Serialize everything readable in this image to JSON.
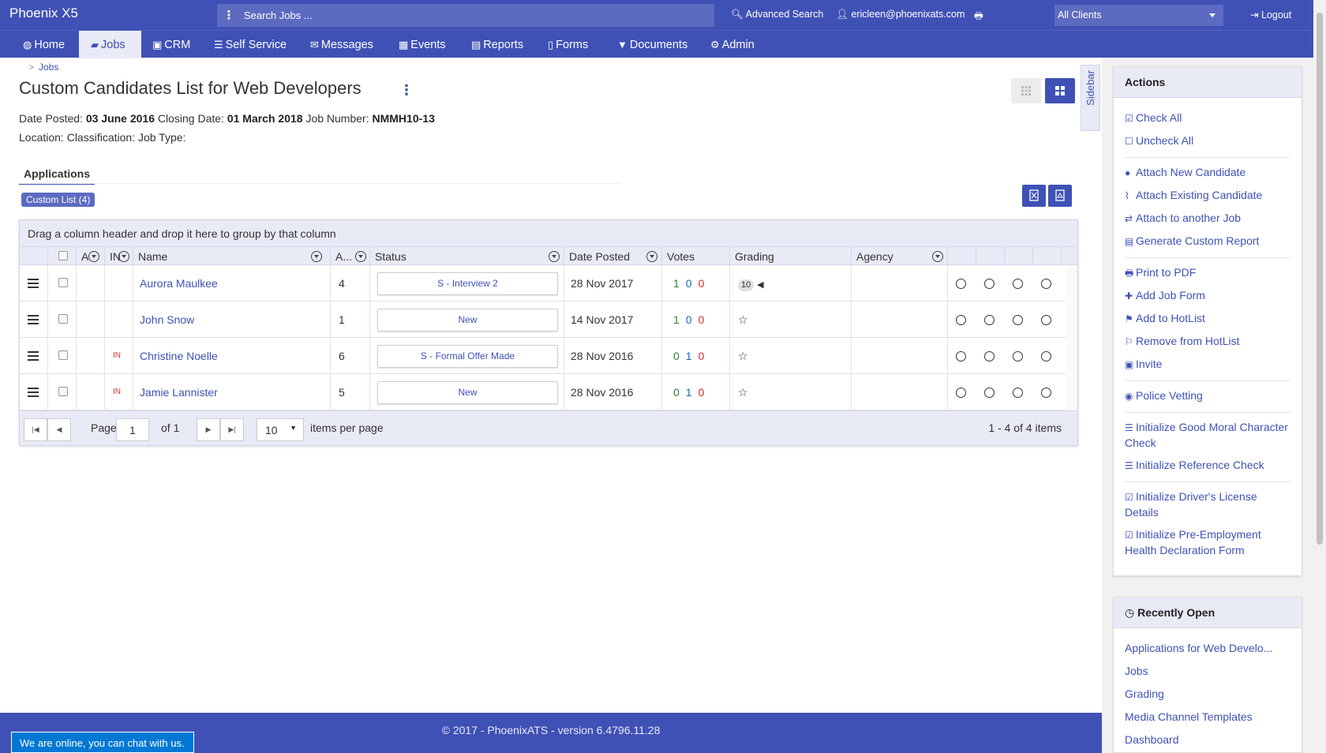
{
  "topbar": {
    "brand": "Phoenix X5",
    "search_placeholder": "Search Jobs ...",
    "advanced_search": "Advanced Search",
    "user_email": "ericleen@phoenixats.com",
    "client_select": "All Clients",
    "logout": "Logout"
  },
  "nav": [
    {
      "label": "Home",
      "icon": "globe-icon"
    },
    {
      "label": "Jobs",
      "icon": "folder-open-icon",
      "active": true
    },
    {
      "label": "CRM",
      "icon": "briefcase-icon"
    },
    {
      "label": "Self Service",
      "icon": "list-icon"
    },
    {
      "label": "Messages",
      "icon": "envelope-icon"
    },
    {
      "label": "Events",
      "icon": "calendar-icon"
    },
    {
      "label": "Reports",
      "icon": "report-icon"
    },
    {
      "label": "Forms",
      "icon": "file-icon"
    },
    {
      "label": "Documents",
      "icon": "filter-icon"
    },
    {
      "label": "Admin",
      "icon": "gear-icon"
    }
  ],
  "breadcrumb": {
    "separator": ">",
    "link": "Jobs"
  },
  "page": {
    "title": "Custom Candidates List for Web Developers",
    "date_posted_label": "Date Posted:",
    "date_posted": "03 June 2016",
    "closing_label": "Closing Date:",
    "closing_date": "01 March 2018",
    "job_number_label": "Job Number:",
    "job_number": "NMMH10-13",
    "meta2": "Location: Classification: Job Type:"
  },
  "sidebar_tab": "Sidebar",
  "tabs": {
    "applications": "Applications",
    "custom_list": "Custom List (4)"
  },
  "grid": {
    "group_hint": "Drag a column header and drop it here to group by that column",
    "headers": {
      "a": "A",
      "in": "IN",
      "name": "Name",
      "a2": "A...",
      "status": "Status",
      "date_posted": "Date Posted",
      "votes": "Votes",
      "grading": "Grading",
      "agency": "Agency"
    },
    "rows": [
      {
        "in": "",
        "name": "Aurora Maulkee",
        "a": "4",
        "status": "S - Interview 2",
        "date": "28 Nov 2017",
        "votes": [
          "1",
          "0",
          "0"
        ],
        "grading_badge": "10",
        "grading": ""
      },
      {
        "in": "",
        "name": "John Snow",
        "a": "1",
        "status": "New",
        "date": "14 Nov 2017",
        "votes": [
          "1",
          "0",
          "0"
        ],
        "grading_badge": "",
        "grading": "☆"
      },
      {
        "in": "IN",
        "name": "Christine Noelle",
        "a": "6",
        "status": "S - Formal Offer Made",
        "date": "28 Nov 2016",
        "votes": [
          "0",
          "1",
          "0"
        ],
        "grading_badge": "",
        "grading": "☆"
      },
      {
        "in": "IN",
        "name": "Jamie Lannister",
        "a": "5",
        "status": "New",
        "date": "28 Nov 2016",
        "votes": [
          "0",
          "1",
          "0"
        ],
        "grading_badge": "",
        "grading": "☆"
      }
    ],
    "pager": {
      "page_label": "Page",
      "page_value": "1",
      "of_label": "of 1",
      "per_page": "10",
      "per_page_label": "items per page",
      "summary": "1 - 4 of 4 items"
    }
  },
  "actions": {
    "title": "Actions",
    "items": [
      {
        "label": "Check All",
        "icon": "check-square-icon"
      },
      {
        "label": "Uncheck All",
        "icon": "square-icon"
      },
      {
        "label": "Attach New Candidate",
        "icon": "user-icon"
      },
      {
        "label": "Attach Existing Candidate",
        "icon": "paperclip-icon"
      },
      {
        "label": "Attach to another Job",
        "icon": "exchange-icon"
      },
      {
        "label": "Generate Custom Report",
        "icon": "report-icon"
      },
      {
        "label": "Print to PDF",
        "icon": "print-icon"
      },
      {
        "label": "Add Job Form",
        "icon": "plus-icon"
      },
      {
        "label": "Add to HotList",
        "icon": "flag-icon"
      },
      {
        "label": "Remove from HotList",
        "icon": "flag-outline-icon"
      },
      {
        "label": "Invite",
        "icon": "briefcase-icon"
      },
      {
        "label": "Police Vetting",
        "icon": "eye-icon"
      },
      {
        "label": "Initialize Good Moral Character Check",
        "icon": "list-icon"
      },
      {
        "label": "Initialize Reference Check",
        "icon": "list-icon"
      },
      {
        "label": "Initialize Driver's License Details",
        "icon": "check-square-icon"
      },
      {
        "label": "Initialize Pre-Employment Health Declaration Form",
        "icon": "check-square-icon"
      }
    ]
  },
  "recent": {
    "title": "Recently Open",
    "items": [
      "Applications for Web Develo...",
      "Jobs",
      "Grading",
      "Media Channel Templates",
      "Dashboard"
    ]
  },
  "footer": "© 2017 - PhoenixATS - version 6.4796.11.28",
  "chat": "We are online, you can chat with us.",
  "colors": {
    "brand": "#3f51b5",
    "header_bg": "#e8eaf6"
  }
}
